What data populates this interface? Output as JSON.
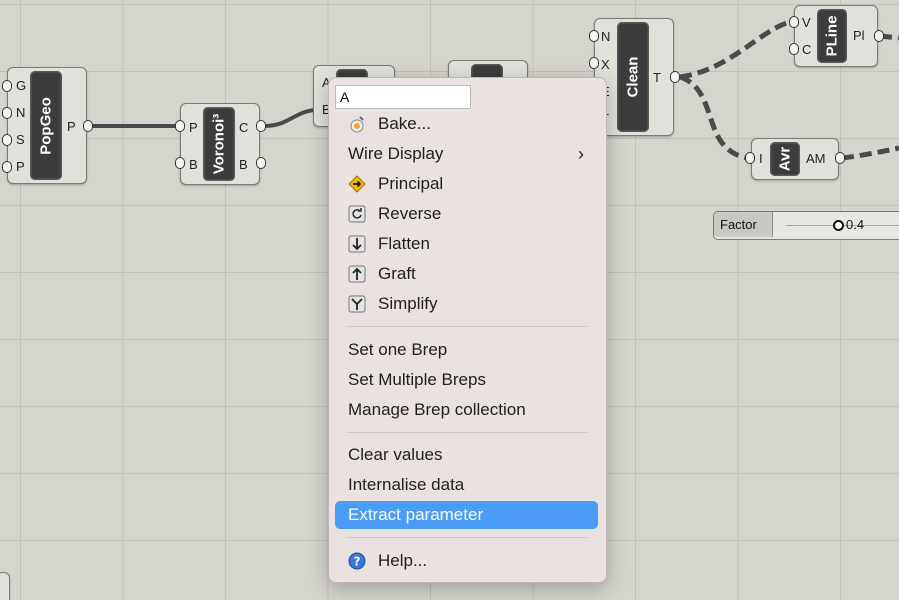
{
  "components": {
    "popgeo": {
      "title": "PopGeo",
      "inputs": [
        "G",
        "N",
        "S",
        "P"
      ],
      "output": "P"
    },
    "voronoi": {
      "title": "Voronoi³",
      "inputs": [
        "P",
        "B"
      ],
      "outputs": [
        "C",
        "B"
      ]
    },
    "brep_param": {
      "inputs": [
        "A",
        "B"
      ]
    },
    "clean": {
      "title": "Clean",
      "inputs": [
        "N",
        "X",
        "E",
        "T"
      ],
      "output": "T"
    },
    "pline": {
      "title": "PLine",
      "inputs": [
        "V",
        "C"
      ],
      "output": "Pl"
    },
    "avr": {
      "title": "Avr",
      "input": "I",
      "output": "AM"
    },
    "factor": {
      "label": "Factor",
      "value": "0.4",
      "value_fraction": 0.4
    }
  },
  "menu": {
    "name_value": "A",
    "items": [
      {
        "label": "Bake...",
        "icon": "bake-icon"
      },
      {
        "label": "Wire Display",
        "submenu": true
      },
      {
        "label": "Principal",
        "icon": "principal-icon"
      },
      {
        "label": "Reverse",
        "icon": "reverse-icon"
      },
      {
        "label": "Flatten",
        "icon": "flatten-icon"
      },
      {
        "label": "Graft",
        "icon": "graft-icon"
      },
      {
        "label": "Simplify",
        "icon": "simplify-icon"
      },
      {
        "label": "Set one Brep"
      },
      {
        "label": "Set Multiple Breps"
      },
      {
        "label": "Manage Brep collection"
      },
      {
        "label": "Clear values"
      },
      {
        "label": "Internalise data"
      },
      {
        "label": "Extract parameter",
        "highlighted": true
      },
      {
        "label": "Help...",
        "icon": "help-icon"
      }
    ],
    "colors": {
      "highlight": "#4a9cf7",
      "background": "#eae1e1"
    }
  }
}
